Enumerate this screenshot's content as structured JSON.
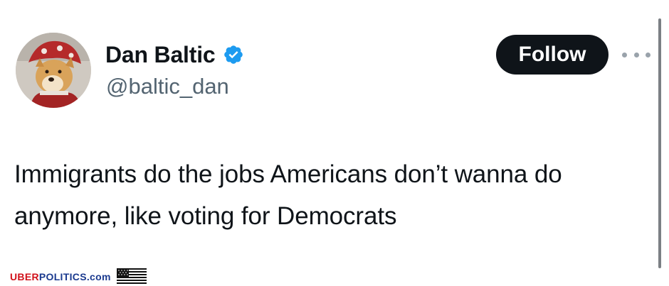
{
  "tweet": {
    "author": {
      "display_name": "Dan Baltic",
      "handle": "@baltic_dan",
      "verified_icon": "verified-badge-icon",
      "avatar_icon": "doge-avatar"
    },
    "follow_label": "Follow",
    "more_icon": "more-dots-icon",
    "text": "Immigrants do the jobs Americans don’t wanna do anymore, like voting for Democrats"
  },
  "watermark": {
    "part1": "UBER",
    "part2": "POLITICS.com",
    "flag_icon": "us-flag-icon"
  },
  "colors": {
    "follow_bg": "#0f1419",
    "verified": "#1d9bf0",
    "handle": "#536471",
    "watermark_red": "#d1121b",
    "watermark_blue": "#1b3a8f"
  }
}
